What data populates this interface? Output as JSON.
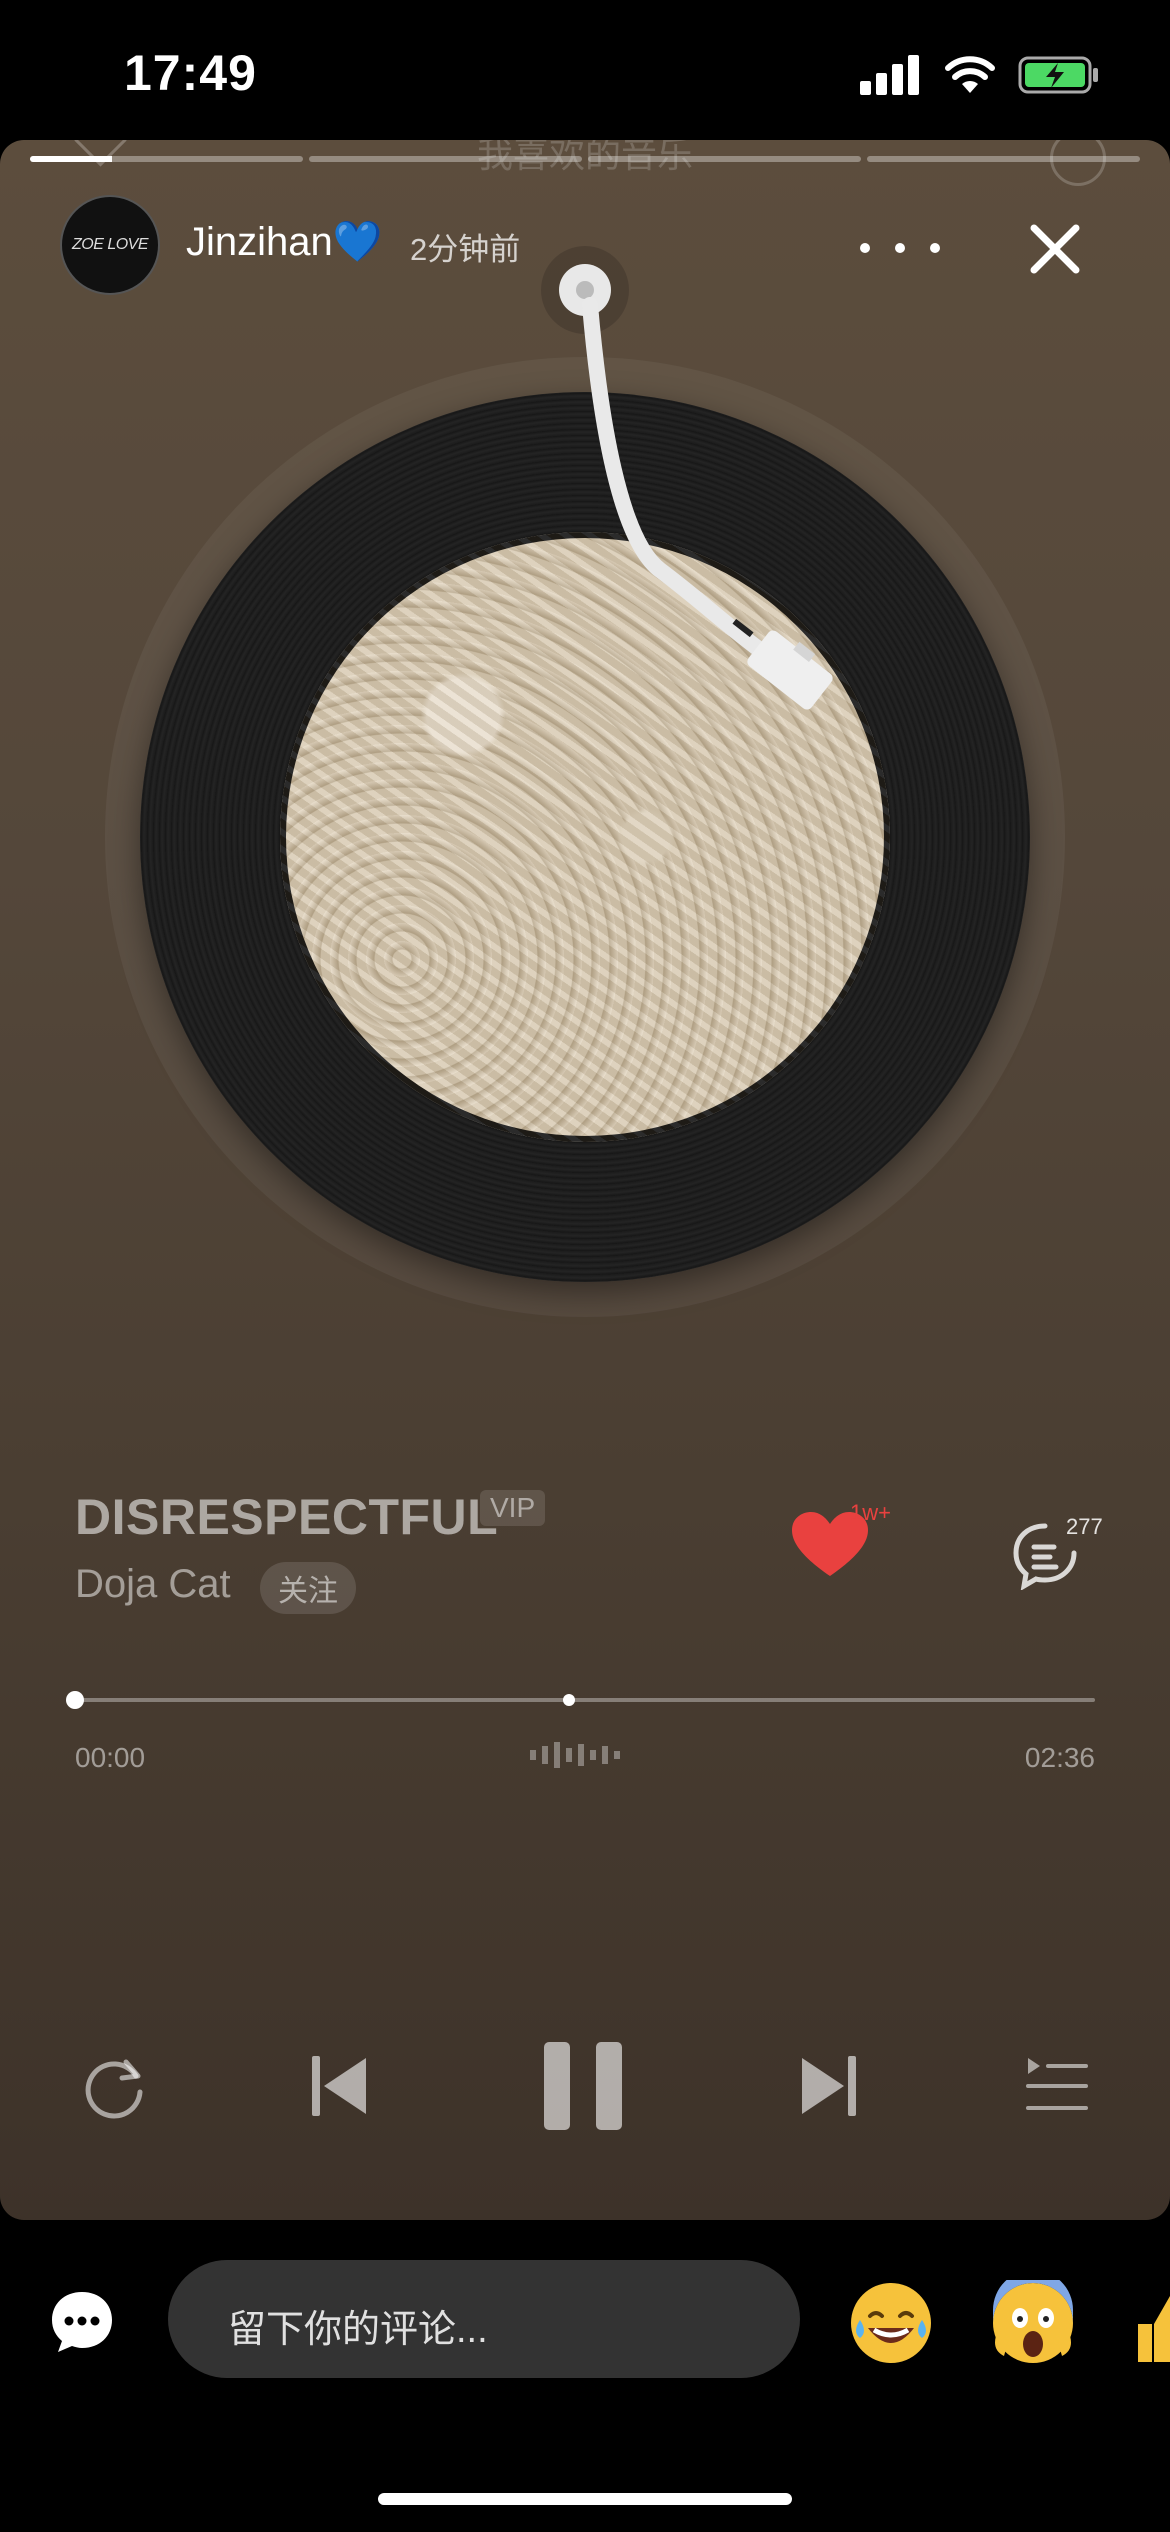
{
  "status_bar": {
    "time": "17:49"
  },
  "story": {
    "header_title": "我喜欢的音乐",
    "segments": [
      {
        "progress": 0.3
      },
      {
        "progress": 0
      },
      {
        "progress": 0
      },
      {
        "progress": 0
      }
    ],
    "username": "Jinzihan💙",
    "posted_ago": "2分钟前",
    "avatar_text": "ZOE LOVE"
  },
  "song": {
    "title": "DISRESPECTFUL",
    "vip_label": "VIP",
    "artist": "Doja Cat",
    "follow_label": "关注",
    "like_count": "1w+",
    "comment_count": "277",
    "time_current": "00:00",
    "time_total": "02:36"
  },
  "footer": {
    "comment_placeholder": "留下你的评论...",
    "emojis": [
      "😂",
      "😱",
      "👍"
    ]
  },
  "colors": {
    "like": "#e9413f",
    "card_bg": "#54473a"
  }
}
